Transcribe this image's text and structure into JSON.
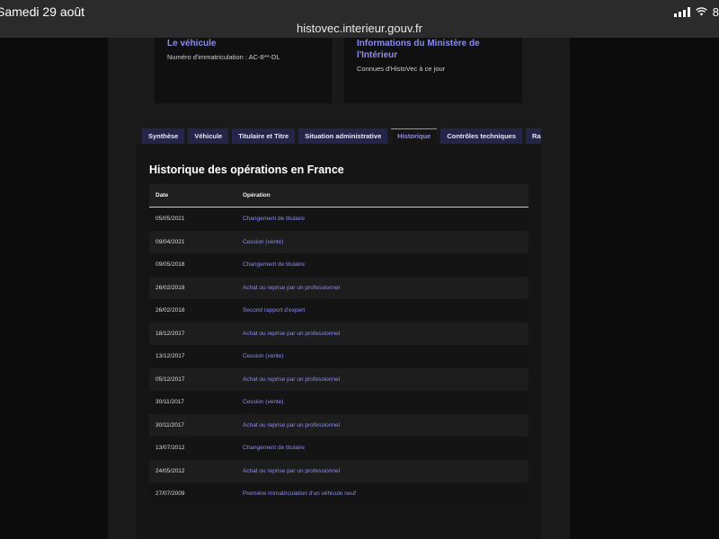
{
  "status_bar": {
    "date": "Samedi 29 août",
    "battery": "8",
    "url": "histovec.interieur.gouv.fr"
  },
  "cards": [
    {
      "title_lines": [
        "Le véhicule"
      ],
      "subtitle": "Numéro d'immatriculation : AC-8**-DL"
    },
    {
      "title_lines": [
        "Informations du Ministère de",
        "l'Intérieur"
      ],
      "subtitle": "Connues d'HistoVec à ce jour"
    }
  ],
  "tabs": [
    {
      "label": "Synthèse",
      "active": false
    },
    {
      "label": "Véhicule",
      "active": false
    },
    {
      "label": "Titulaire et Titre",
      "active": false
    },
    {
      "label": "Situation administrative",
      "active": false
    },
    {
      "label": "Historique",
      "active": true
    },
    {
      "label": "Contrôles techniques",
      "active": false
    },
    {
      "label": "Rapport",
      "active": false
    }
  ],
  "history": {
    "title": "Historique des opérations en France",
    "columns": {
      "date": "Date",
      "operation": "Opération"
    },
    "rows": [
      {
        "date": "05/05/2021",
        "operation": "Changement de titulaire"
      },
      {
        "date": "09/04/2021",
        "operation": "Cession (vente)"
      },
      {
        "date": "09/05/2018",
        "operation": "Changement de titulaire"
      },
      {
        "date": "26/02/2018",
        "operation": "Achat ou reprise par un professionnel"
      },
      {
        "date": "26/02/2018",
        "operation": "Second rapport d'expert"
      },
      {
        "date": "18/12/2017",
        "operation": "Achat ou reprise par un professionnel"
      },
      {
        "date": "13/12/2017",
        "operation": "Cession (vente)"
      },
      {
        "date": "05/12/2017",
        "operation": "Achat ou reprise par un professionnel"
      },
      {
        "date": "30/11/2017",
        "operation": "Cession (vente)"
      },
      {
        "date": "30/11/2017",
        "operation": "Achat ou reprise par un professionnel"
      },
      {
        "date": "13/07/2012",
        "operation": "Changement de titulaire"
      },
      {
        "date": "24/05/2012",
        "operation": "Achat ou reprise par un professionnel"
      },
      {
        "date": "27/07/2009",
        "operation": "Première immatriculation d'un véhicule neuf"
      }
    ]
  },
  "colors": {
    "accent": "#8c8cf0",
    "tab_bg": "#25254a",
    "background": "#0c0c0c"
  }
}
